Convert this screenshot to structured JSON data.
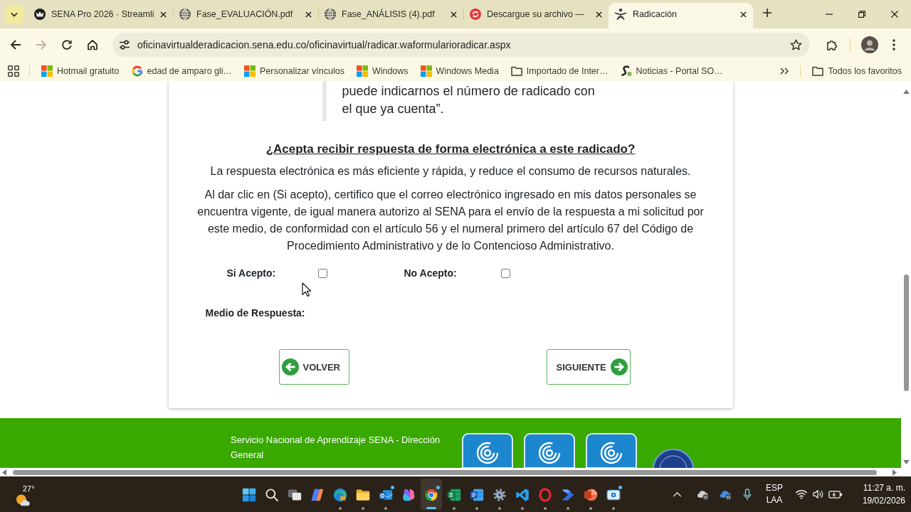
{
  "browser": {
    "tabs": [
      {
        "title": "SENA Pro 2026 · Streamli",
        "kind": "crown",
        "selected": false
      },
      {
        "title": "Fase_EVALUACIÓN.pdf",
        "kind": "globe",
        "selected": false
      },
      {
        "title": "Fase_ANÁLISIS (4).pdf",
        "kind": "globe",
        "selected": false
      },
      {
        "title": "Descargue su archivo —",
        "kind": "sync",
        "selected": false
      },
      {
        "title": "Radicación",
        "kind": "sena",
        "selected": true
      }
    ],
    "navigation": [
      {
        "kind": "back",
        "disabled": false
      },
      {
        "kind": "forward",
        "disabled": true
      },
      {
        "kind": "reload",
        "disabled": false
      },
      {
        "kind": "home",
        "disabled": false
      }
    ],
    "address": "oficinavirtualderadicacion.sena.edu.co/oficinavirtual/radicar.waformularioradicar.aspx",
    "bookmarks": [
      {
        "label": "Hotmail gratuito",
        "kind": "windows"
      },
      {
        "label": "edad de amparo gli…",
        "kind": "google"
      },
      {
        "label": "Personalizar vínculos",
        "kind": "windows"
      },
      {
        "label": "Windows",
        "kind": "windows"
      },
      {
        "label": "Windows Media",
        "kind": "windows"
      },
      {
        "label": "Importado de Inter…",
        "kind": "folder"
      },
      {
        "label": "Noticias - Portal SO…",
        "kind": "sp"
      }
    ],
    "all_bookmarks": "Todos los favoritos"
  },
  "page": {
    "quote": "puede indicarnos el número de radicado con el que ya cuenta”.",
    "heading": "¿Acepta recibir respuesta de forma electrónica a este radicado?",
    "intro": "La respuesta electrónica es más eficiente y rápida, y reduce el consumo de recursos naturales.",
    "statement": "Al dar clic en (Si acepto), certifico que el correo electrónico ingresado en mis datos personales se encuentra vigente, de igual manera autorizo al SENA para el envío de la respuesta a mi solicitud por este medio, de conformidad con el artículo 56 y el numeral primero del artículo 67 del Código de Procedimiento Administrativo y de lo Contencioso Administrativo.",
    "options": [
      {
        "label": "Si Acepto:",
        "checked": false
      },
      {
        "label": "No Acepto:",
        "checked": false
      }
    ],
    "response_medium": "Medio de Respuesta:",
    "buttons": [
      {
        "label": "VOLVER",
        "kind": "back"
      },
      {
        "label": "SIGUIENTE",
        "kind": "next"
      }
    ]
  },
  "footer": {
    "text": "Servicio Nacional de Aprendizaje SENA - Dirección General"
  },
  "taskbar": {
    "weather": "27°",
    "apps": [
      {
        "kind": "start",
        "running": false,
        "selected": false,
        "badge": false
      },
      {
        "kind": "search",
        "running": false,
        "selected": false,
        "badge": false
      },
      {
        "kind": "taskview",
        "running": false,
        "selected": false,
        "badge": false
      },
      {
        "kind": "copilot",
        "running": false,
        "selected": false,
        "badge": false
      },
      {
        "kind": "edge",
        "running": true,
        "selected": false,
        "badge": false
      },
      {
        "kind": "files",
        "running": true,
        "selected": false,
        "badge": false
      },
      {
        "kind": "outlook",
        "running": true,
        "selected": false,
        "badge": true
      },
      {
        "kind": "m365",
        "running": false,
        "selected": false,
        "badge": false
      },
      {
        "kind": "chrome",
        "running": true,
        "selected": true,
        "badge": true
      },
      {
        "kind": "excel",
        "running": true,
        "selected": false,
        "badge": false
      },
      {
        "kind": "word",
        "running": true,
        "selected": false,
        "badge": false
      },
      {
        "kind": "settings",
        "running": true,
        "selected": false,
        "badge": false
      },
      {
        "kind": "vscode",
        "running": true,
        "selected": false,
        "badge": false
      },
      {
        "kind": "opera",
        "running": true,
        "selected": false,
        "badge": false
      },
      {
        "kind": "automate",
        "running": true,
        "selected": false,
        "badge": false
      },
      {
        "kind": "powerpoint",
        "running": true,
        "selected": false,
        "badge": false
      },
      {
        "kind": "snipping",
        "running": true,
        "selected": false,
        "badge": true
      }
    ],
    "language": [
      "ESP",
      "LAA"
    ],
    "time": "11:27 a. m.",
    "date": "19/02/2026"
  }
}
